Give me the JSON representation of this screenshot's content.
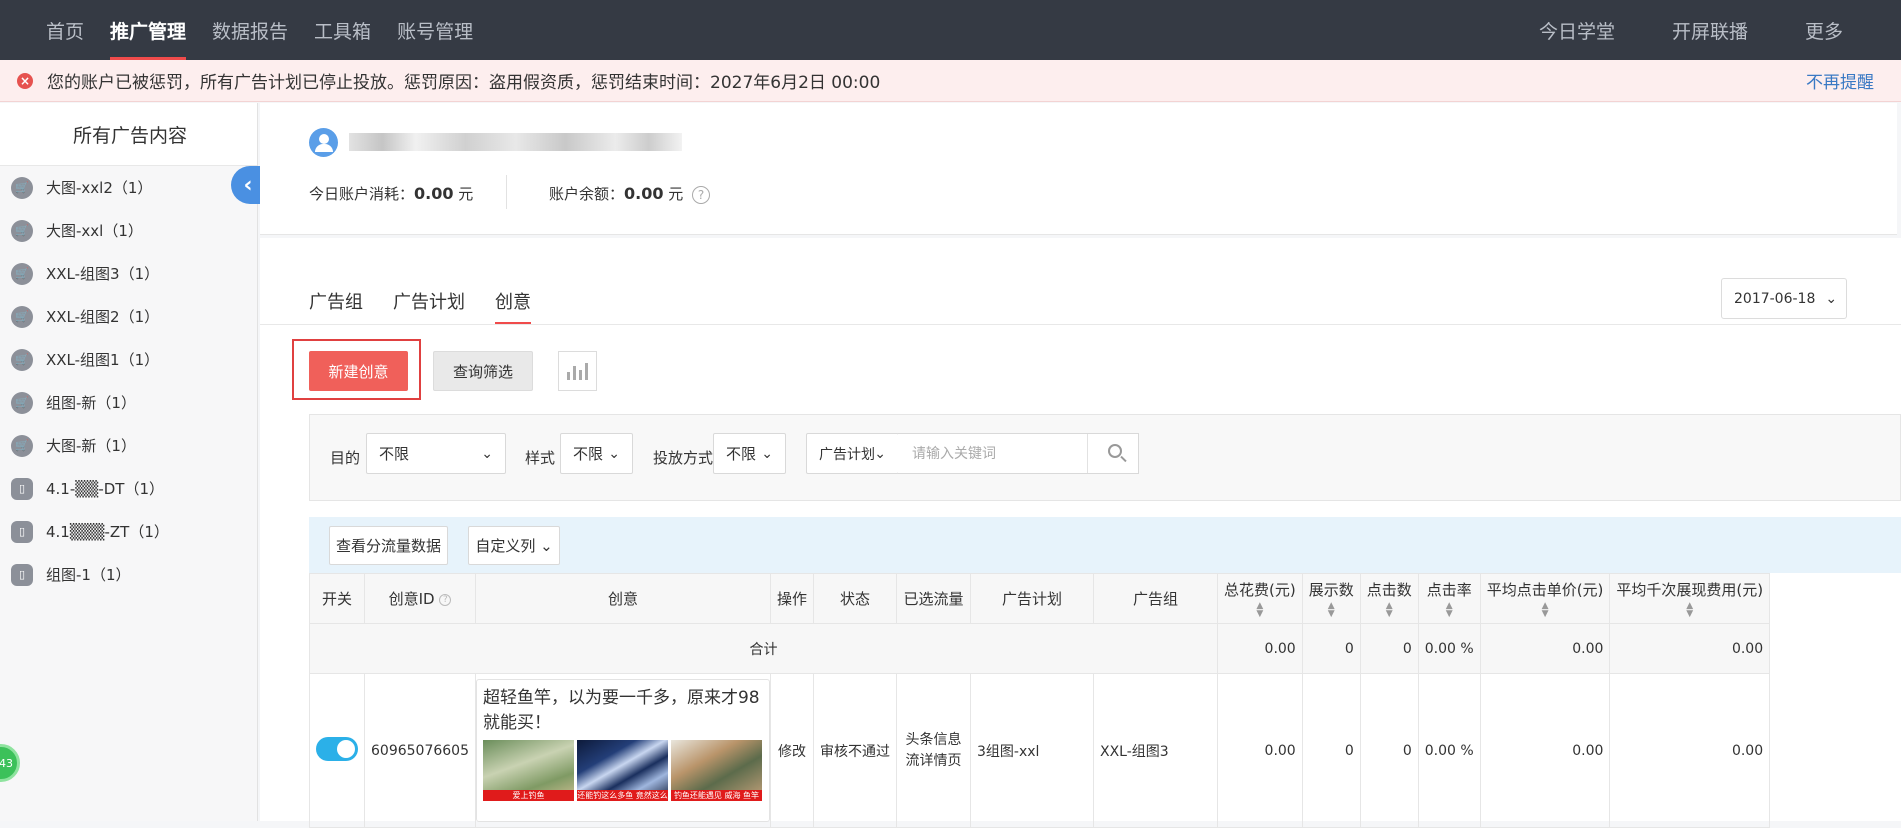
{
  "nav": {
    "left": [
      "首页",
      "推广管理",
      "数据报告",
      "工具箱",
      "账号管理"
    ],
    "active": "推广管理",
    "right": [
      "今日学堂",
      "开屏联播",
      "更多"
    ]
  },
  "notice": {
    "text": "您的账户已被惩罚，所有广告计划已停止投放。惩罚原因：盗用假资质，惩罚结束时间：2027年6月2日 00:00",
    "dismiss": "不再提醒"
  },
  "sidebar": {
    "title": "所有广告内容",
    "items": [
      {
        "label": "大图-xxl2（1）",
        "icon": "cart-icon"
      },
      {
        "label": "大图-xxl（1）",
        "icon": "cart-icon"
      },
      {
        "label": "XXL-组图3（1）",
        "icon": "cart-icon"
      },
      {
        "label": "XXL-组图2（1）",
        "icon": "cart-icon"
      },
      {
        "label": "XXL-组图1（1）",
        "icon": "cart-icon"
      },
      {
        "label": "组图-新（1）",
        "icon": "cart-icon"
      },
      {
        "label": "大图-新（1）",
        "icon": "cart-icon"
      },
      {
        "label": "4.1-▒▒-DT（1）",
        "icon": "phone-icon"
      },
      {
        "label": "4.1▒▒▒-ZT（1）",
        "icon": "phone-icon"
      },
      {
        "label": "组图-1（1）",
        "icon": "phone-icon"
      }
    ],
    "floating_badge": "43"
  },
  "account": {
    "today_spend_label": "今日账户消耗：",
    "today_spend_value": "0.00",
    "today_spend_unit": "元",
    "balance_label": "账户余额：",
    "balance_value": "0.00",
    "balance_unit": "元"
  },
  "tabs": [
    "广告组",
    "广告计划",
    "创意"
  ],
  "active_tab": "创意",
  "date": "2017-06-18",
  "actions": {
    "new_creative": "新建创意",
    "query_filter": "查询筛选"
  },
  "filters": {
    "purpose_label": "目的",
    "purpose_value": "不限",
    "style_label": "样式",
    "style_value": "不限",
    "delivery_label": "投放方式",
    "delivery_value": "不限",
    "scope_value": "广告计划",
    "search_placeholder": "请输入关键词"
  },
  "toolbar": {
    "traffic_button": "查看分流量数据",
    "custom_columns": "自定义列"
  },
  "table": {
    "headers": [
      "开关",
      "创意ID",
      "创意",
      "操作",
      "状态",
      "已选流量",
      "广告计划",
      "广告组",
      "总花费(元)",
      "展示数",
      "点击数",
      "点击率",
      "平均点击单价(元)",
      "平均千次展现费用(元)"
    ],
    "summary": {
      "label": "合计",
      "total_cost": "0.00",
      "impressions": "0",
      "clicks": "0",
      "ctr": "0.00 %",
      "avg_cpc": "0.00",
      "avg_cpm": "0.00"
    },
    "rows": [
      {
        "id": "60965076605",
        "creative_title": "超轻鱼竿，以为要一千多，原来才98就能买！",
        "thumb_captions": [
          "爱上钓鱼",
          "还能钓这么多鱼 竟然这么便宜",
          "钓鱼还能遇见 威海 鱼竿"
        ],
        "action": "修改",
        "status": "审核不通过",
        "traffic": "头条信息流详情页",
        "plan": "3组图-xxl",
        "group": "XXL-组图3",
        "total_cost": "0.00",
        "impressions": "0",
        "clicks": "0",
        "ctr": "0.00 %",
        "avg_cpc": "0.00",
        "avg_cpm": "0.00"
      }
    ]
  }
}
